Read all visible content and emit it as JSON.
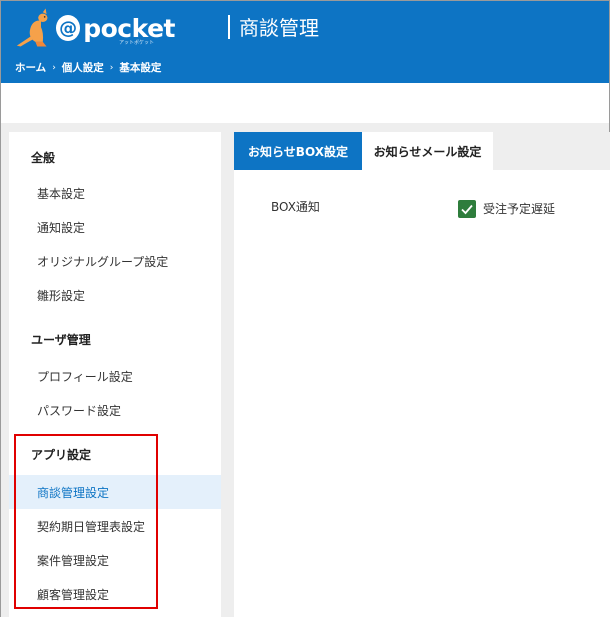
{
  "app": {
    "logo_at": "@",
    "logo_word": "pocket",
    "logo_sub": "アットポケット",
    "page_title": "商談管理"
  },
  "breadcrumb": {
    "items": [
      "ホーム",
      "個人設定",
      "基本設定"
    ],
    "separator": "›"
  },
  "sidebar": {
    "sections": [
      {
        "title": "全般",
        "items": [
          "基本設定",
          "通知設定",
          "オリジナルグループ設定",
          "雛形設定"
        ]
      },
      {
        "title": "ユーザ管理",
        "items": [
          "プロフィール設定",
          "パスワード設定"
        ]
      },
      {
        "title": "アプリ設定",
        "items": [
          "商談管理設定",
          "契約期日管理表設定",
          "案件管理設定",
          "顧客管理設定"
        ]
      }
    ],
    "active_item": "商談管理設定"
  },
  "tabs": {
    "box": "お知らせBOX設定",
    "mail": "お知らせメール設定",
    "active": "お知らせBOX設定"
  },
  "settings": {
    "box_notification_label": "BOX通知",
    "option_label": "受注予定遅延",
    "option_checked": true
  },
  "colors": {
    "brand_blue": "#0d74c4",
    "check_green": "#2e7d3c",
    "highlight_red": "#e00000"
  }
}
